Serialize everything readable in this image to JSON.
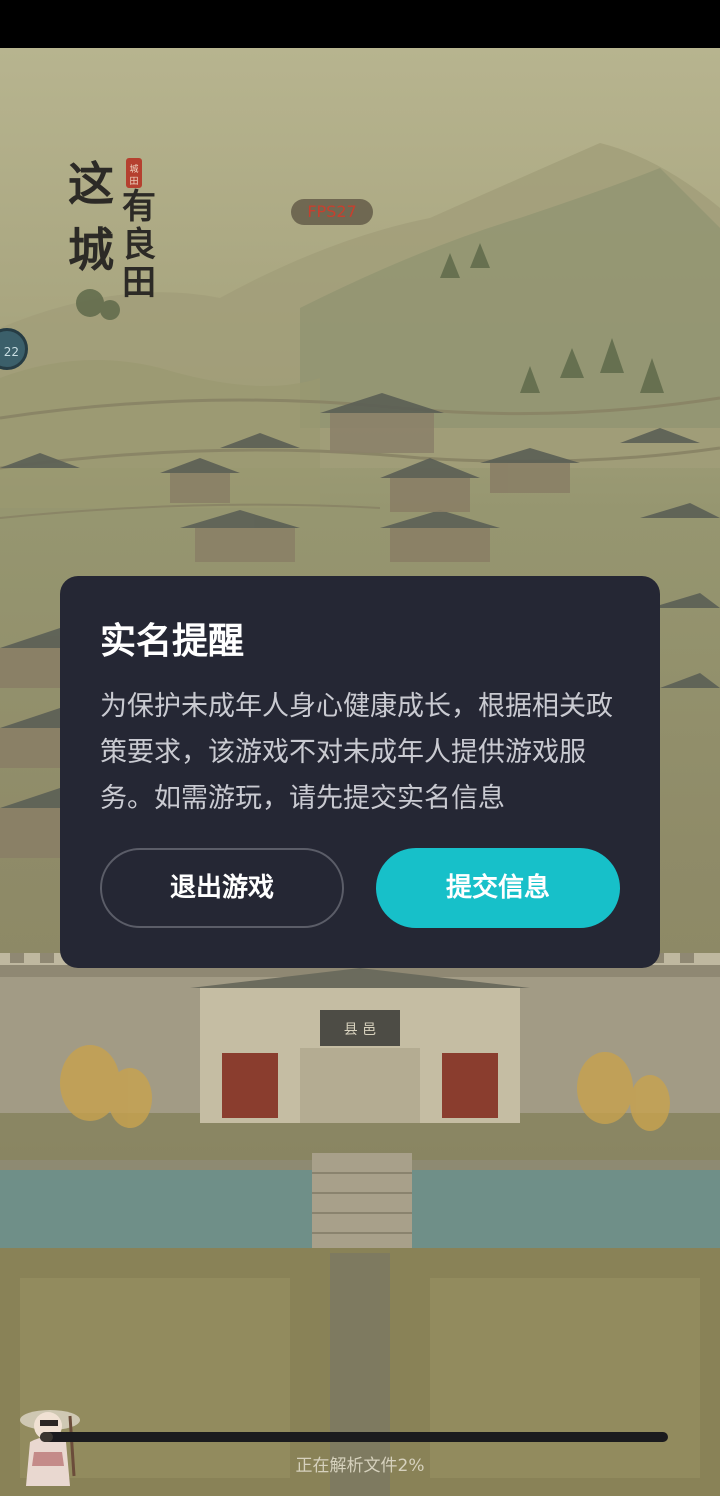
{
  "game": {
    "logo_text": "这城有良田",
    "logo_seal": "城田",
    "fps": "FPS27",
    "side_badge": "22"
  },
  "dialog": {
    "title": "实名提醒",
    "body": "为保护未成年人身心健康成长，根据相关政策要求，该游戏不对未成年人提供游戏服务。如需游玩，请先提交实名信息",
    "exit_label": "退出游戏",
    "submit_label": "提交信息"
  },
  "loading": {
    "text": "正在解析文件2%",
    "progress": 0.02
  },
  "colors": {
    "dialog_bg": "#252734",
    "accent": "#17c0c9",
    "fps_text": "#c7402e"
  }
}
